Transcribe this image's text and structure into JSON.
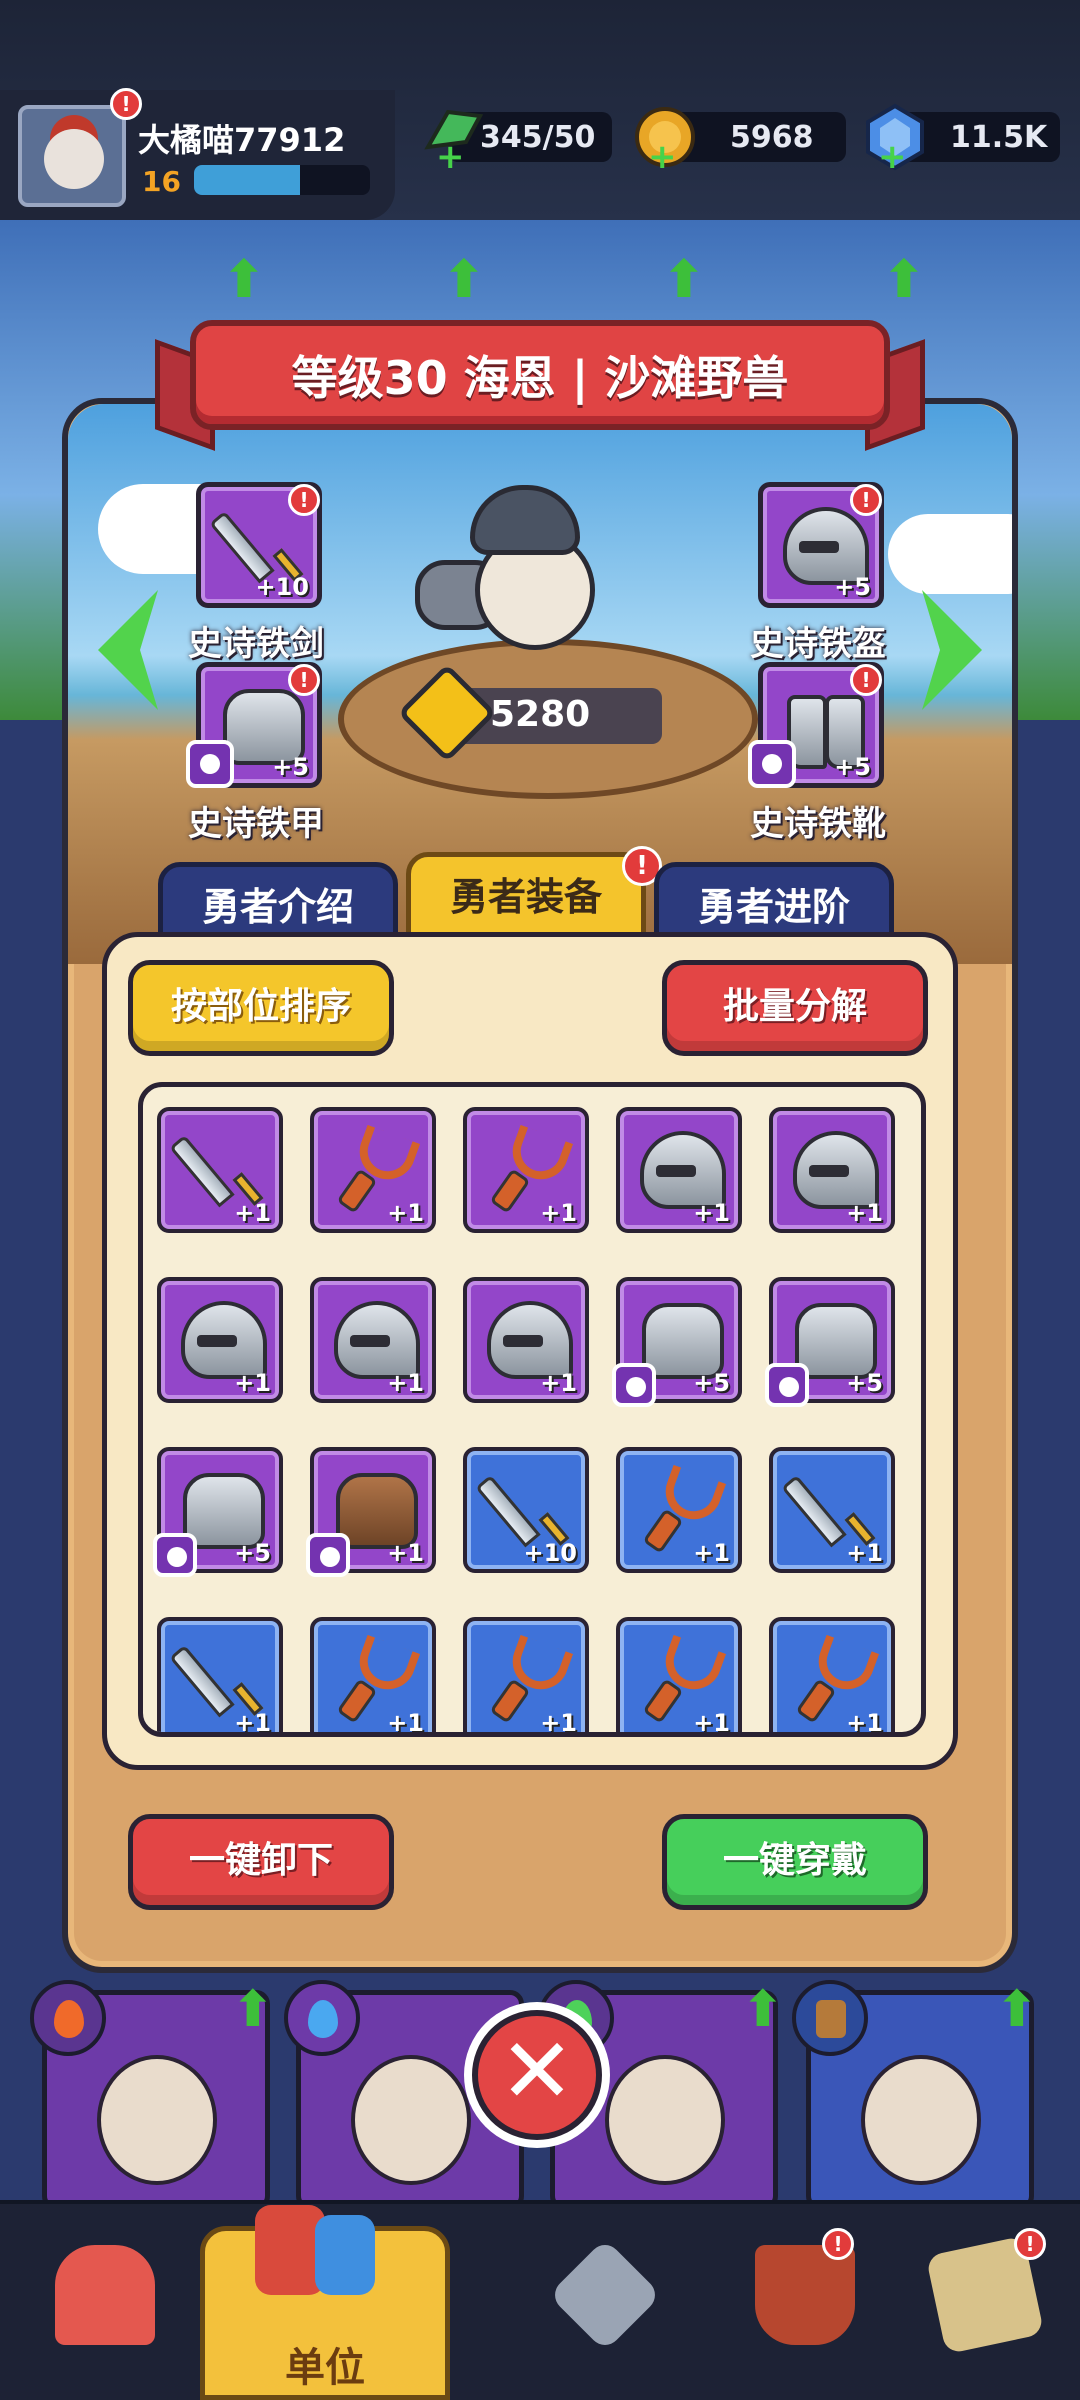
{
  "player": {
    "name": "大橘喵77912",
    "level": "16",
    "xp_progress": 0.6
  },
  "resources": {
    "energy": "345/50",
    "coins": "5968",
    "gems": "11.5K"
  },
  "hero": {
    "title": "等级30 海恩 | 沙滩野兽",
    "power": "5280"
  },
  "equipment_slots": [
    {
      "name": "史诗铁剑",
      "level": "+10",
      "icon": "sword-icon"
    },
    {
      "name": "史诗铁盔",
      "level": "+5",
      "icon": "helmet-icon"
    },
    {
      "name": "史诗铁甲",
      "level": "+5",
      "icon": "armor-icon"
    },
    {
      "name": "史诗铁靴",
      "level": "+5",
      "icon": "boots-icon"
    }
  ],
  "tabs": [
    {
      "label": "勇者介绍"
    },
    {
      "label": "勇者装备",
      "active": true
    },
    {
      "label": "勇者进阶"
    }
  ],
  "actions": {
    "sort": "按部位排序",
    "bulk_decompose": "批量分解",
    "unequip_all": "一键卸下",
    "equip_all": "一键穿戴"
  },
  "inventory": [
    {
      "type": "sword",
      "rarity": "purple",
      "level": "+1"
    },
    {
      "type": "slingshot",
      "rarity": "purple",
      "level": "+1"
    },
    {
      "type": "slingshot",
      "rarity": "purple",
      "level": "+1"
    },
    {
      "type": "helmet",
      "rarity": "purple",
      "level": "+1"
    },
    {
      "type": "helmet",
      "rarity": "purple",
      "level": "+1"
    },
    {
      "type": "helmet",
      "rarity": "purple",
      "level": "+1"
    },
    {
      "type": "helmet",
      "rarity": "purple",
      "level": "+1"
    },
    {
      "type": "helmet",
      "rarity": "purple",
      "level": "+1"
    },
    {
      "type": "armor",
      "rarity": "purple",
      "level": "+5",
      "badge": true
    },
    {
      "type": "armor",
      "rarity": "purple",
      "level": "+5",
      "badge": true
    },
    {
      "type": "armor",
      "rarity": "purple",
      "level": "+5",
      "badge": true
    },
    {
      "type": "armor-brown",
      "rarity": "purple",
      "level": "+1",
      "badge": true
    },
    {
      "type": "sword",
      "rarity": "blue",
      "level": "+10"
    },
    {
      "type": "slingshot",
      "rarity": "blue",
      "level": "+1"
    },
    {
      "type": "sword",
      "rarity": "blue",
      "level": "+1"
    },
    {
      "type": "sword",
      "rarity": "blue",
      "level": "+1"
    },
    {
      "type": "slingshot",
      "rarity": "blue",
      "level": "+1"
    },
    {
      "type": "slingshot",
      "rarity": "blue",
      "level": "+1"
    },
    {
      "type": "slingshot",
      "rarity": "blue",
      "level": "+1"
    },
    {
      "type": "slingshot",
      "rarity": "blue",
      "level": "+1"
    }
  ],
  "bottom_nav": {
    "unit_label": "单位"
  },
  "colors": {
    "rarity_purple": "#9346c9",
    "rarity_blue": "#3f72d9",
    "alert_red": "#e23b3b",
    "accent_green": "#46cf5b",
    "accent_yellow": "#f4c62b"
  }
}
